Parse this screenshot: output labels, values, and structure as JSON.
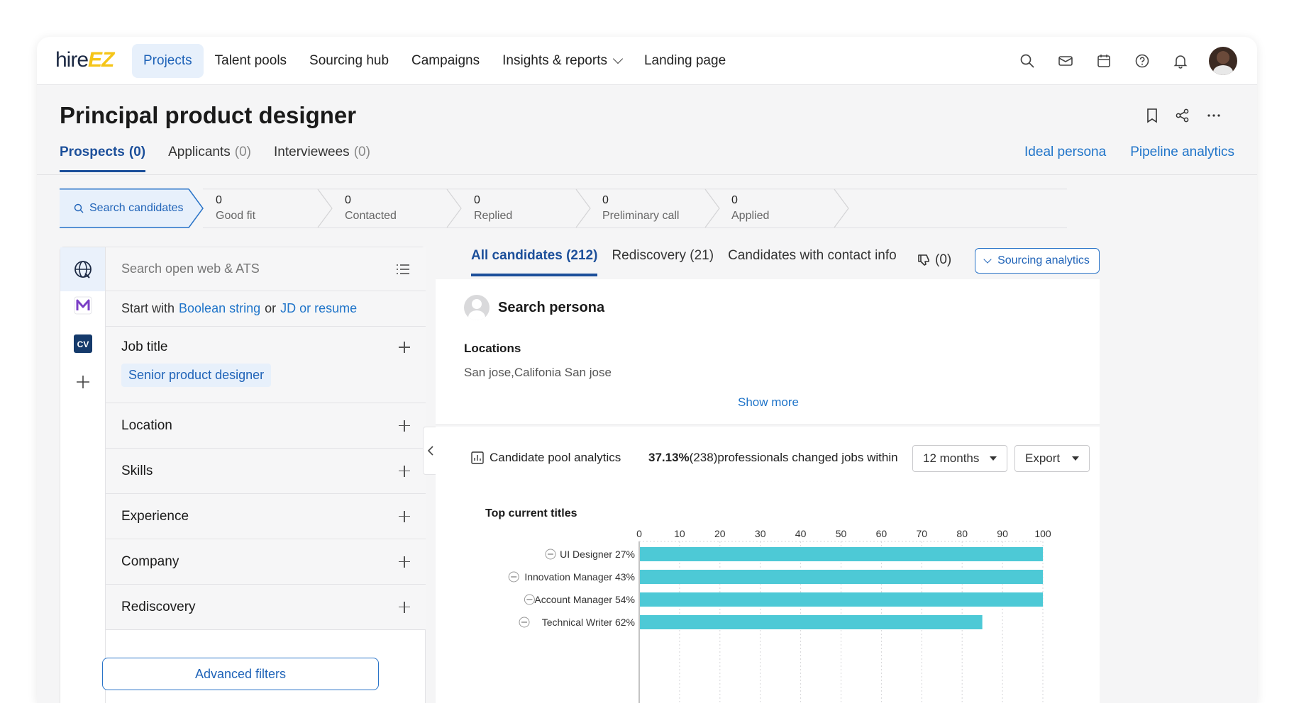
{
  "nav": {
    "logo_hire": "hire",
    "logo_ez": "EZ",
    "items": [
      {
        "label": "Projects",
        "active": true
      },
      {
        "label": "Talent pools"
      },
      {
        "label": "Sourcing hub"
      },
      {
        "label": "Campaigns"
      },
      {
        "label": "Insights & reports",
        "dropdown": true
      },
      {
        "label": "Landing page"
      }
    ],
    "icons": [
      "search-icon",
      "mail-icon",
      "calendar-icon",
      "help-icon",
      "bell-icon"
    ]
  },
  "header": {
    "title": "Principal product designer",
    "icons": [
      "bookmark-icon",
      "share-icon",
      "more-icon"
    ]
  },
  "tabs": [
    {
      "label": "Prospects",
      "count": "(0)",
      "active": true
    },
    {
      "label": "Applicants",
      "count": "(0)"
    },
    {
      "label": "Interviewees",
      "count": "(0)"
    }
  ],
  "right_links": [
    "Ideal persona",
    "Pipeline analytics"
  ],
  "pipeline": {
    "search_label": "Search candidates",
    "stages": [
      {
        "count": "0",
        "label": "Good fit"
      },
      {
        "count": "0",
        "label": "Contacted"
      },
      {
        "count": "0",
        "label": "Replied"
      },
      {
        "count": "0",
        "label": "Preliminary call"
      },
      {
        "count": "0",
        "label": "Applied"
      }
    ]
  },
  "search_panel": {
    "placeholder": "Search open web & ATS",
    "start_with": "Start with",
    "boolean_link": "Boolean string",
    "or": "or",
    "jd_link": "JD or resume",
    "filters": [
      {
        "label": "Job title",
        "chip": "Senior product designer"
      },
      {
        "label": "Location"
      },
      {
        "label": "Skills"
      },
      {
        "label": "Experience"
      },
      {
        "label": "Company"
      },
      {
        "label": "Rediscovery"
      }
    ],
    "advanced_filters": "Advanced filters"
  },
  "candidate_tabs": [
    {
      "label": "All candidates (212)",
      "active": true
    },
    {
      "label": "Rediscovery (21)"
    },
    {
      "label": "Candidates with contact info"
    }
  ],
  "thumbs_count": "(0)",
  "sourcing_analytics": "Sourcing analytics",
  "persona": {
    "title": "Search persona",
    "locations_label": "Locations",
    "locations_value": "San jose,Califonia San jose",
    "show_more": "Show more"
  },
  "analytics": {
    "title": "Candidate pool analytics",
    "stat_pct": "37.13%",
    "stat_rest": "(238)professionals changed jobs within",
    "period": "12 months",
    "export": "Export",
    "chart_title": "Top current titles"
  },
  "chart_data": {
    "type": "bar",
    "orientation": "horizontal",
    "title": "Top current titles",
    "categories": [
      "UI Designer 27%",
      "Innovation Manager 43%",
      "Account Manager 54%",
      "Technical Writer 62%"
    ],
    "values": [
      100,
      100,
      100,
      85
    ],
    "xlim": [
      0,
      100
    ],
    "xticks": [
      "0",
      "10",
      "20",
      "30",
      "40",
      "50",
      "60",
      "70",
      "80",
      "90",
      "100"
    ],
    "color": "#4dc9d6",
    "grid": true
  }
}
